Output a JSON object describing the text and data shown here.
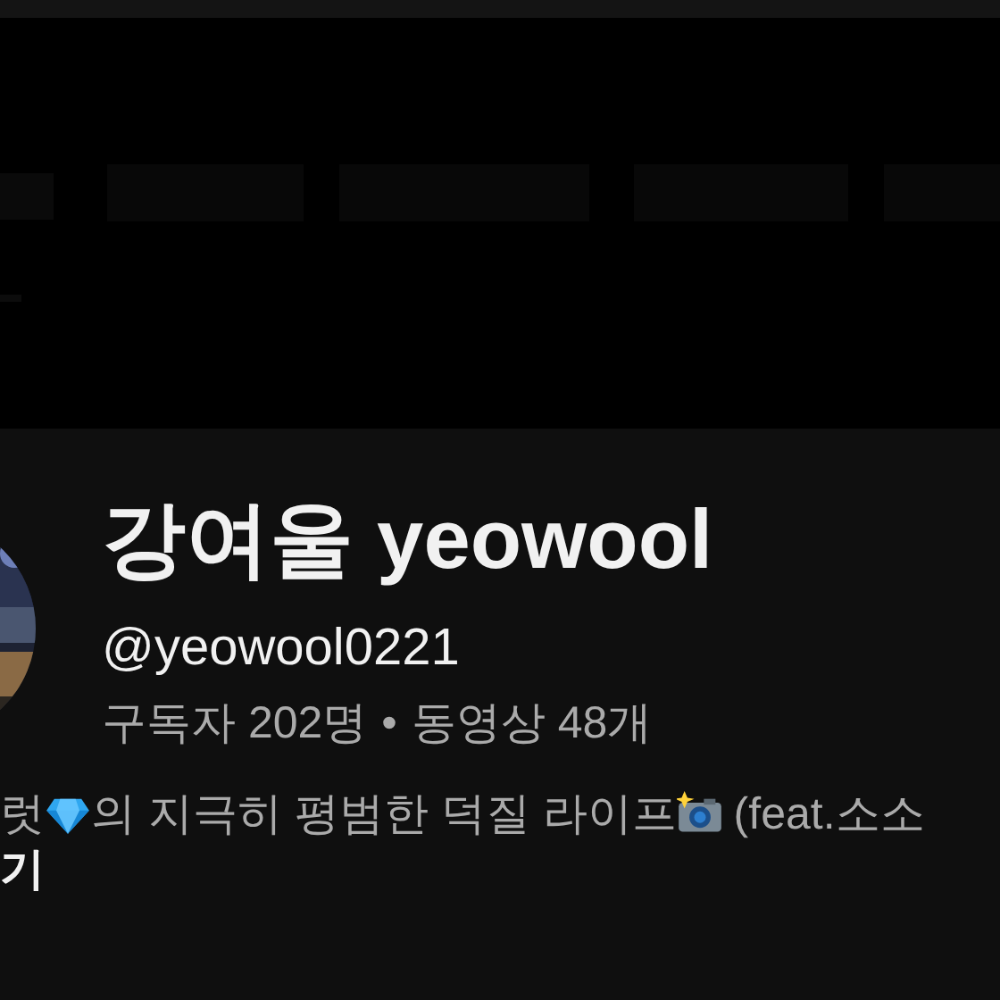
{
  "channel": {
    "name": "강여울 yeowool",
    "handle": "@yeowool0221",
    "stats": [
      "구독자 202명",
      "동영상 48개"
    ],
    "separator": "•",
    "description": [
      {
        "kind": "text",
        "text": "럿"
      },
      {
        "kind": "diamond"
      },
      {
        "kind": "text",
        "text": "의 지극히 평범한 덕질 라이프"
      },
      {
        "kind": "camera"
      },
      {
        "kind": "text",
        "text": "(feat.소소"
      }
    ],
    "more": "기"
  }
}
